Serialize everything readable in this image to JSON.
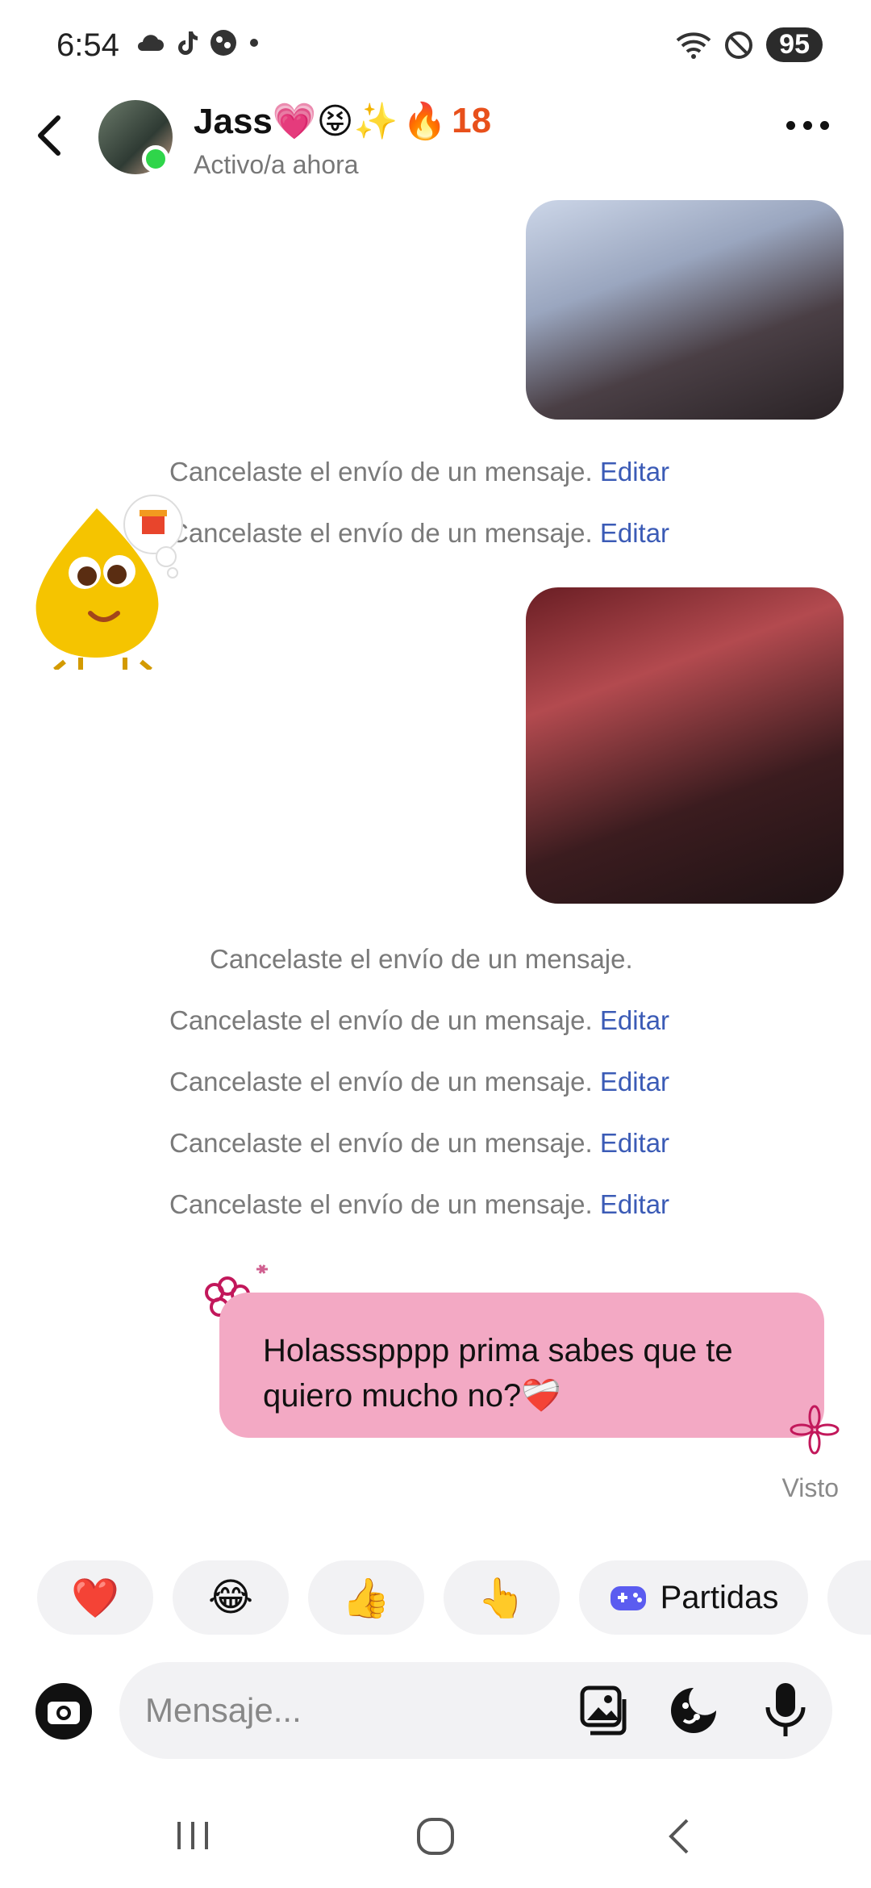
{
  "status_bar": {
    "time": "6:54",
    "battery": "95",
    "icons": [
      "cloud-icon",
      "tiktok-icon",
      "app-icon",
      "dot-icon",
      "wifi-icon",
      "do-not-disturb-icon"
    ]
  },
  "header": {
    "name": "Jass💗😝✨",
    "streak_emoji": "🔥",
    "streak_count": "18",
    "status": "Activo/a ahora"
  },
  "messages": {
    "unsent_text": "Cancelaste el envío de un mensaje.",
    "edit_label": "Editar",
    "bubble_text": "Holassspppp prima sabes que te quiero mucho no?❤️‍🩹",
    "seen": "Visto"
  },
  "quick_reactions": {
    "heart": "❤️",
    "laugh": "😂",
    "thumbs_up": "👍",
    "point": "👆",
    "games_label": "Partidas"
  },
  "composer": {
    "placeholder": "Mensaje..."
  },
  "colors": {
    "bubble": "#f3a9c4",
    "edit_link": "#3b5bb6",
    "online": "#2fd54a",
    "streak": "#e8501b"
  }
}
